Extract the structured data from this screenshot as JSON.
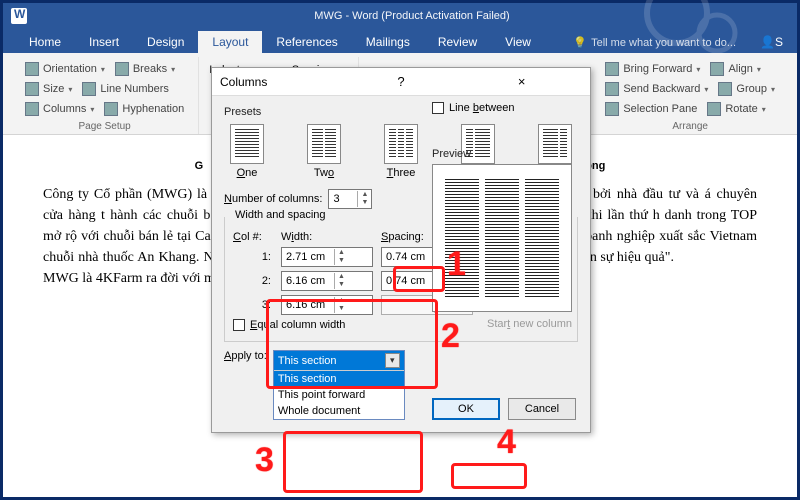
{
  "title": "MWG - Word (Product Activation Failed)",
  "tabs": [
    "Home",
    "Insert",
    "Design",
    "Layout",
    "References",
    "Mailings",
    "Review",
    "View"
  ],
  "tellme": "Tell me what you want to do...",
  "ribbon": {
    "orientation": "Orientation",
    "breaks": "Breaks",
    "size": "Size",
    "lineNumbers": "Line Numbers",
    "columns": "Columns",
    "hyphenation": "Hyphenation",
    "pageSetup": "Page Setup",
    "indent": "Indent",
    "spacing": "Spacing",
    "bringForward": "Bring Forward",
    "sendBackward": "Send Backward",
    "selectionPane": "Selection Pane",
    "align": "Align",
    "group": "Group",
    "rotate": "Rotate",
    "arrange": "Arrange"
  },
  "doc": {
    "heading_left": "G",
    "heading_right": "Di Động",
    "col1": "Công ty Cổ phần (MWG) là nhà b doanh thu và lợi 4.500 cửa hàng t hành các chuỗi b Điện Máy Xanh, MWG còn mở rộ với chuỗi bán lẻ tại Campuchia cũng như đầu tư vào chuỗi nhà thuốc An Khang. Năm 2020, thành viên mới của MWG là 4KFarm ra đời với mục",
    "col2": "oanh nghiệp hoạt động nhận bởi nhà đầu tư và á chuyên nghiệp, MWG động tin yêu khi lần thứ h danh trong TOP 50 ôi trường làm việc tốt à doanh nghiệp xuất sắc Vietnam HR Awards – \"Chiến lược nhân sự hiệu quả\"."
  },
  "dialog": {
    "title": "Columns",
    "help": "?",
    "close": "×",
    "presetsLabel": "Presets",
    "presets": {
      "one": "One",
      "two": "Two",
      "three": "Three",
      "left": "Left",
      "right": "Right"
    },
    "numColsLabel": "Number of columns:",
    "numCols": "3",
    "lineBetween": "Line between",
    "widthSpacing": "Width and spacing",
    "colHdr": "Col #:",
    "widthHdr": "Width:",
    "spacingHdr": "Spacing:",
    "rows": [
      {
        "n": "1:",
        "w": "2.71 cm",
        "s": "0.74 cm"
      },
      {
        "n": "2:",
        "w": "6.16 cm",
        "s": "0.74 cm"
      },
      {
        "n": "3:",
        "w": "6.16 cm",
        "s": ""
      }
    ],
    "equal": "Equal column width",
    "previewLabel": "Preview",
    "startNew": "Start new column",
    "applyTo": "Apply to:",
    "applySel": "This section",
    "applyOpts": [
      "This section",
      "This point forward",
      "Whole document"
    ],
    "ok": "OK",
    "cancel": "Cancel"
  },
  "ann": {
    "a1": "1",
    "a2": "2",
    "a3": "3",
    "a4": "4"
  }
}
